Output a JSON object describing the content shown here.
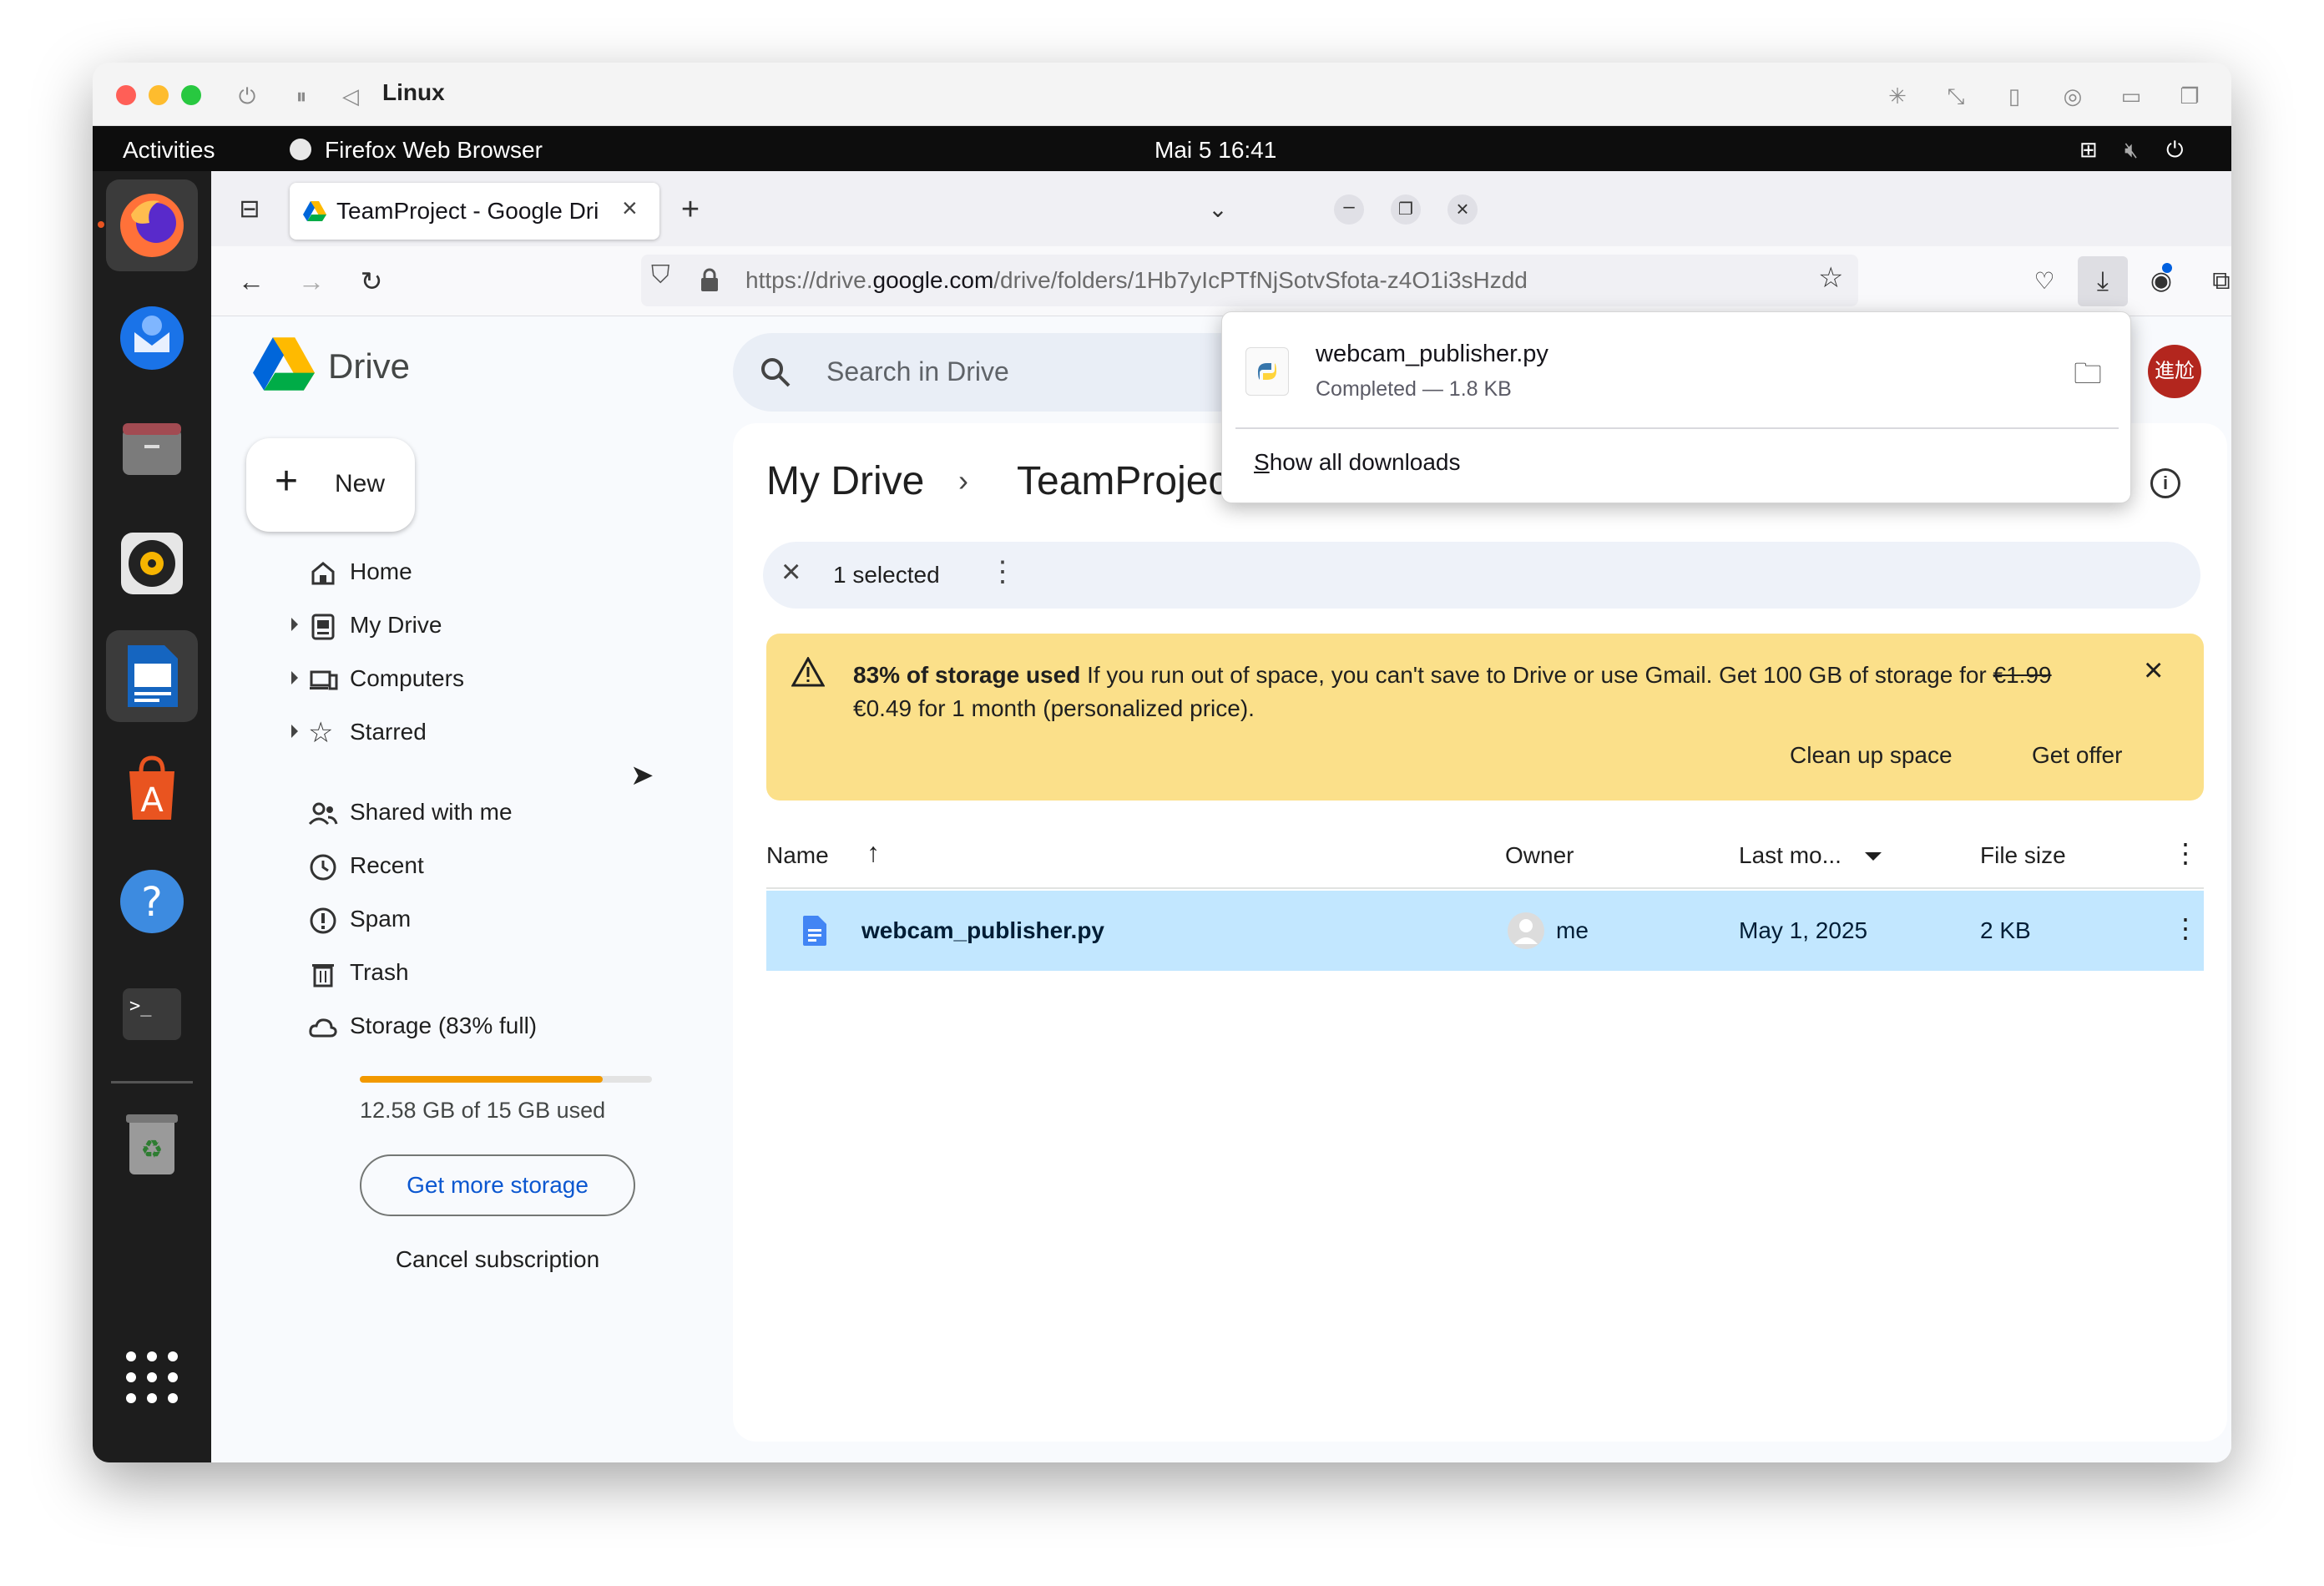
{
  "vm_window": {
    "title": "Linux"
  },
  "gnome_top_bar": {
    "activities": "Activities",
    "app_name": "Firefox Web Browser",
    "clock": "Mai 5  16:41"
  },
  "dock": {
    "apps": [
      "firefox-icon",
      "thunderbird-icon",
      "files-icon",
      "rhythmbox-icon",
      "writer-icon",
      "app-center-icon",
      "help-icon",
      "terminal-icon",
      "trash-icon",
      "show-apps-icon"
    ]
  },
  "browser": {
    "tab_title": "TeamProject - Google Dri",
    "url_prefix": "https://drive.",
    "url_domain": "google.com",
    "url_path": "/drive/folders/1Hb7yIcPTfNjSotvSfota-z4O1i3sHzdd"
  },
  "downloads": {
    "file_name": "webcam_publisher.py",
    "status": "Completed — 1.8 KB",
    "show_all_accel": "S",
    "show_all_rest": "how all downloads"
  },
  "drive": {
    "logo_text": "Drive",
    "search_placeholder": "Search in Drive",
    "new_button": "New",
    "avatar_text": "進尬",
    "nav": {
      "home": "Home",
      "my_drive": "My Drive",
      "computers": "Computers",
      "starred": "Starred",
      "shared": "Shared with me",
      "recent": "Recent",
      "spam": "Spam",
      "trash": "Trash",
      "storage": "Storage (83% full)"
    },
    "storage_fraction": 0.83,
    "storage_used_text": "12.58 GB of 15 GB used",
    "get_more_storage": "Get more storage",
    "cancel_subscription": "Cancel subscription",
    "breadcrumb": {
      "root": "My Drive",
      "current": "TeamProjec"
    },
    "selection": {
      "count_text": "1 selected"
    },
    "banner": {
      "bold": "83% of storage used",
      "text": " If you run out of space, you can't save to Drive or use Gmail. Get 100 GB of storage for ",
      "old_price": "€1.99",
      "line2": "€0.49 for 1 month (personalized price).",
      "clean_up": "Clean up space",
      "get_offer": "Get offer"
    },
    "table": {
      "headers": {
        "name": "Name",
        "owner": "Owner",
        "last_modified": "Last mo...",
        "file_size": "File size"
      },
      "rows": [
        {
          "name": "webcam_publisher.py",
          "owner": "me",
          "modified": "May 1, 2025",
          "size": "2 KB"
        }
      ]
    }
  },
  "colors": {
    "selected_row": "#c2e7ff",
    "banner": "#fbe08a",
    "storage_bar": "#f29900",
    "link_blue": "#0b57d0",
    "avatar": "#b3261e"
  }
}
